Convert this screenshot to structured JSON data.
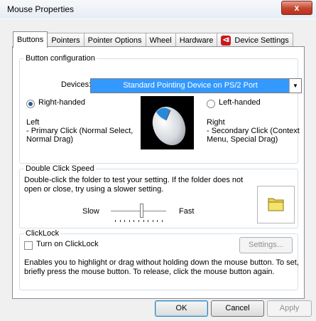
{
  "window": {
    "title": "Mouse Properties",
    "close_label": "x"
  },
  "tabs": [
    {
      "label": "Buttons"
    },
    {
      "label": "Pointers"
    },
    {
      "label": "Pointer Options"
    },
    {
      "label": "Wheel"
    },
    {
      "label": "Hardware"
    },
    {
      "label": "Device Settings"
    }
  ],
  "button_config": {
    "legend": "Button configuration",
    "devices_label": "Devices:",
    "devices_value": "Standard Pointing Device on PS/2 Port",
    "right_handed": "Right-handed",
    "left_handed": "Left-handed",
    "left_title": "Left",
    "left_desc1": " - Primary Click (Normal Select,",
    "left_desc2": "Normal Drag)",
    "right_title": "Right",
    "right_desc1": " - Secondary Click (Context",
    "right_desc2": "Menu, Special Drag)",
    "selected": "Right-handed"
  },
  "double_click": {
    "legend": "Double Click Speed",
    "desc1": "Double-click the folder to test your setting.  If the folder does not",
    "desc2": "open or close, try using a slower setting.",
    "slow": "Slow",
    "fast": "Fast",
    "speed_fraction": 0.55
  },
  "clicklock": {
    "legend": "ClickLock",
    "checkbox": "Turn on ClickLock",
    "checked": false,
    "settings": "Settings...",
    "desc1": "Enables you to highlight or drag without holding down the mouse button.  To set,",
    "desc2": "briefly press the mouse button.  To release, click the mouse button again."
  },
  "footer": {
    "ok": "OK",
    "cancel": "Cancel",
    "apply": "Apply"
  },
  "colors": {
    "accent": "#3399ff",
    "device_icon": "#c8181e",
    "close": "#c4442d"
  }
}
